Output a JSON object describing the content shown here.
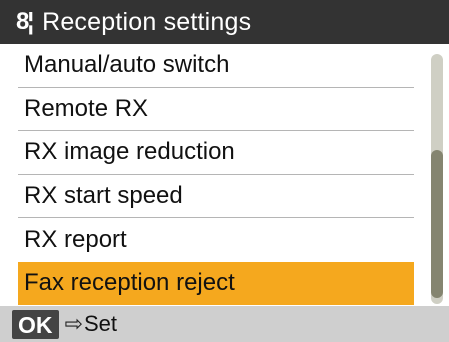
{
  "title_bar": {
    "icon": "settings-icon",
    "icon_glyph": "8¦",
    "title": "Reception settings"
  },
  "menu": {
    "items": [
      {
        "label": "Manual/auto switch"
      },
      {
        "label": "Remote RX"
      },
      {
        "label": "RX image reduction"
      },
      {
        "label": "RX start speed"
      },
      {
        "label": "RX report"
      },
      {
        "label": "Fax reception reject"
      }
    ],
    "selected_index": 5
  },
  "scrollbar": {
    "position_fraction": 0.55,
    "visible_fraction": 0.6
  },
  "footer": {
    "ok_key": "OK",
    "arrow_icon": "arrow-right-icon",
    "action_label": "Set"
  },
  "colors": {
    "title_bg": "#333333",
    "selected_bg": "#f5a81e",
    "footer_bg": "#cfcfcf",
    "scroll_track": "#cfcfc4",
    "scroll_thumb": "#858570"
  }
}
